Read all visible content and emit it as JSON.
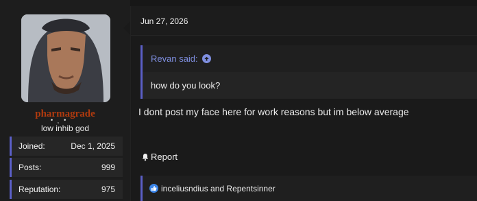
{
  "user": {
    "username": "pharmagrade",
    "title": "low inhib god",
    "avatar_icon": "user-avatar-photo",
    "username_color": "#b03a0e",
    "stats": [
      {
        "label": "Joined:",
        "value": "Dec 1, 2025"
      },
      {
        "label": "Posts:",
        "value": "999"
      },
      {
        "label": "Reputation:",
        "value": "975"
      }
    ]
  },
  "post": {
    "date": "Jun 27, 2026",
    "quote": {
      "author": "Revan said:",
      "jump_icon": "arrow-up-circle-icon",
      "text": "how do you look?"
    },
    "body": "I dont post my face here for work reasons but im below average",
    "report_label": "Report",
    "report_icon": "bell-icon",
    "reactions": {
      "icon": "thumbs-up-icon",
      "text": "inceliusndius and Repentsinner"
    }
  },
  "colors": {
    "accent": "#5b5fc7",
    "quote_author": "#7f8fe0",
    "like": "#3a84e8"
  }
}
